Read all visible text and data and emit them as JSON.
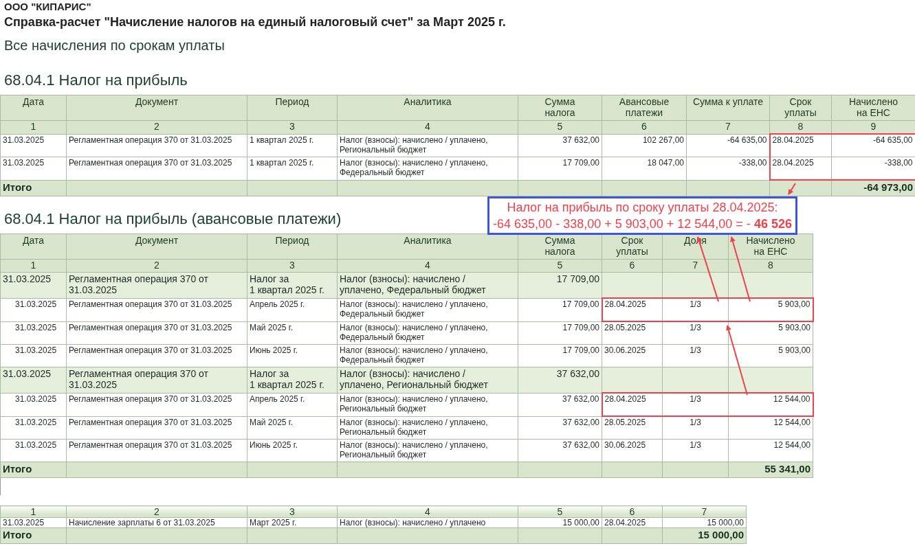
{
  "company": "ООО \"КИПАРИС\"",
  "report_title": "Справка-расчет \"Начисление налогов на единый налоговый счет\" за Март 2025 г.",
  "subtitle": "Все начисления по срокам уплаты",
  "sections": [
    {
      "title": "68.04.1 Налог на прибыль",
      "columns": [
        {
          "label": "Дата",
          "number": "1",
          "kind": "text",
          "highlighted": false
        },
        {
          "label": "Документ",
          "number": "2",
          "kind": "text",
          "highlighted": false
        },
        {
          "label": "Период",
          "number": "3",
          "kind": "text",
          "highlighted": false
        },
        {
          "label": "Аналитика",
          "number": "4",
          "kind": "text",
          "highlighted": false
        },
        {
          "label": "Сумма\nналога",
          "number": "5",
          "kind": "amount",
          "highlighted": false
        },
        {
          "label": "Авансовые\nплатежи",
          "number": "6",
          "kind": "amount",
          "highlighted": false
        },
        {
          "label": "Сумма к уплате",
          "number": "7",
          "kind": "amount",
          "highlighted": false
        },
        {
          "label": "Срок\nуплаты",
          "number": "8",
          "kind": "text",
          "highlighted": true
        },
        {
          "label": "Начислено\nна ЕНС",
          "number": "9",
          "kind": "amount",
          "highlighted": true
        }
      ],
      "rows": [
        {
          "kind": "detail",
          "highlighted": true,
          "cells": [
            "31.03.2025",
            "Регламентная операция 370 от 31.03.2025",
            "1 квартал 2025 г.",
            "Налог (взносы): начислено / уплачено,\nРегиональный бюджет",
            "37 632,00",
            "102 267,00",
            "-64 635,00",
            "28.04.2025",
            "-64 635,00"
          ]
        },
        {
          "kind": "detail",
          "highlighted": true,
          "cells": [
            "31.03.2025",
            "Регламентная операция 370 от 31.03.2025",
            "1 квартал 2025 г.",
            "Налог (взносы): начислено / уплачено,\nФедеральный бюджет",
            "17 709,00",
            "18 047,00",
            "-338,00",
            "28.04.2025",
            "-338,00"
          ]
        }
      ],
      "total": {
        "label": "Итого",
        "value": "-64 973,00"
      }
    },
    {
      "title": "68.04.1 Налог на прибыль (авансовые платежи)",
      "columns": [
        {
          "label": "Дата",
          "number": "1",
          "kind": "text",
          "highlighted": false
        },
        {
          "label": "Документ",
          "number": "2",
          "kind": "text",
          "highlighted": false
        },
        {
          "label": "Период",
          "number": "3",
          "kind": "text",
          "highlighted": false
        },
        {
          "label": "Аналитика",
          "number": "4",
          "kind": "text",
          "highlighted": false
        },
        {
          "label": "Сумма\nналога",
          "number": "5",
          "kind": "amount",
          "highlighted": false
        },
        {
          "label": "Срок\nуплаты",
          "number": "6",
          "kind": "text",
          "highlighted": true
        },
        {
          "label": "Доля",
          "number": "7",
          "kind": "share",
          "highlighted": true
        },
        {
          "label": "Начислено\nна ЕНС",
          "number": "8",
          "kind": "amount",
          "highlighted": true
        }
      ],
      "rows": [
        {
          "kind": "group",
          "highlighted": false,
          "cells": [
            "31.03.2025",
            "Регламентная операция 370 от\n31.03.2025",
            "Налог за\n1 квартал 2025 г.",
            "Налог (взносы): начислено /\nуплачено, Федеральный бюджет",
            "17 709,00"
          ]
        },
        {
          "kind": "child",
          "highlighted": true,
          "cells": [
            "31.03.2025",
            "Регламентная операция 370 от 31.03.2025",
            "Апрель 2025 г.",
            "Налог (взносы): начислено / уплачено,\nФедеральный бюджет",
            "17 709,00",
            "28.04.2025",
            "1/3",
            "5 903,00"
          ]
        },
        {
          "kind": "child",
          "highlighted": false,
          "cells": [
            "31.03.2025",
            "Регламентная операция 370 от 31.03.2025",
            "Май 2025 г.",
            "Налог (взносы): начислено / уплачено,\nФедеральный бюджет",
            "17 709,00",
            "28.05.2025",
            "1/3",
            "5 903,00"
          ]
        },
        {
          "kind": "child",
          "highlighted": false,
          "cells": [
            "31.03.2025",
            "Регламентная операция 370 от 31.03.2025",
            "Июнь 2025 г.",
            "Налог (взносы): начислено / уплачено,\nФедеральный бюджет",
            "17 709,00",
            "30.06.2025",
            "1/3",
            "5 903,00"
          ]
        },
        {
          "kind": "group",
          "highlighted": false,
          "cells": [
            "31.03.2025",
            "Регламентная операция 370 от\n31.03.2025",
            "Налог за\n1 квартал 2025 г.",
            "Налог (взносы): начислено /\nуплачено, Региональный бюджет",
            "37 632,00"
          ]
        },
        {
          "kind": "child",
          "highlighted": true,
          "cells": [
            "31.03.2025",
            "Регламентная операция 370 от 31.03.2025",
            "Апрель 2025 г.",
            "Налог (взносы): начислено / уплачено,\nРегиональный бюджет",
            "37 632,00",
            "28.04.2025",
            "1/3",
            "12 544,00"
          ]
        },
        {
          "kind": "child",
          "highlighted": false,
          "cells": [
            "31.03.2025",
            "Регламентная операция 370 от 31.03.2025",
            "Май 2025 г.",
            "Налог (взносы): начислено / уплачено,\nРегиональный бюджет",
            "37 632,00",
            "28.05.2025",
            "1/3",
            "12 544,00"
          ]
        },
        {
          "kind": "child",
          "highlighted": false,
          "cells": [
            "31.03.2025",
            "Регламентная операция 370 от 31.03.2025",
            "Июнь 2025 г.",
            "Налог (взносы): начислено / уплачено,\nРегиональный бюджет",
            "37 632,00",
            "30.06.2025",
            "1/3",
            "12 544,00"
          ]
        }
      ],
      "total": {
        "label": "Итого",
        "value": "55 341,00"
      }
    },
    {
      "columns": [
        {
          "number": "1",
          "kind": "text"
        },
        {
          "number": "2",
          "kind": "text"
        },
        {
          "number": "3",
          "kind": "text"
        },
        {
          "number": "4",
          "kind": "text"
        },
        {
          "number": "5",
          "kind": "amount"
        },
        {
          "number": "6",
          "kind": "text"
        },
        {
          "number": "7",
          "kind": "amount"
        }
      ],
      "rows": [
        {
          "kind": "detail",
          "cells": [
            "31.03.2025",
            "Начисление зарплаты 6 от 31.03.2025",
            "Март 2025 г.",
            "Налог (взносы): начислено / уплачено",
            "15 000,00",
            "28.04.2025",
            "15 000,00"
          ]
        }
      ],
      "total": {
        "label": "Итого",
        "value": "15 000,00"
      }
    }
  ],
  "callout": {
    "line_1": "Налог на прибыль по сроку уплаты 28.04.2025:",
    "line_2": "-64 635,00 - 338,00 + 5 903,00 + 12 544,00 = - **46 526**"
  }
}
